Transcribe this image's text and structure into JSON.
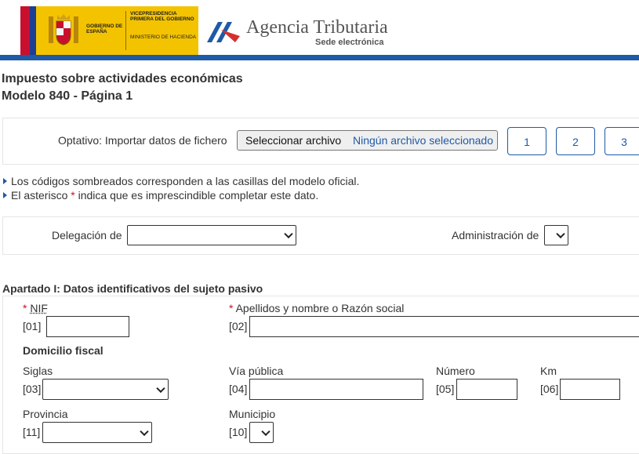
{
  "header": {
    "gov_line1": "GOBIERNO DE ESPAÑA",
    "gov_line2": "VICEPRESIDENCIA PRIMERA DEL GOBIERNO",
    "gov_line3": "MINISTERIO DE HACIENDA",
    "agency_name": "Agencia Tributaria",
    "agency_sub": "Sede electrónica",
    "colors": {
      "brand_blue": "#1f5aa6",
      "gov_yellow": "#f4c300",
      "gov_red": "#c8102e"
    }
  },
  "page": {
    "title_line1": "Impuesto sobre actividades económicas",
    "title_line2": "Modelo 840 - Página 1"
  },
  "import": {
    "label": "Optativo: Importar datos de fichero",
    "button": "Seleccionar archivo",
    "status": "Ningún archivo seleccionado",
    "pages": [
      "1",
      "2",
      "3"
    ]
  },
  "notes": {
    "line1": "Los códigos sombreados corresponden a las casillas del modelo oficial.",
    "line2_before": "El asterisco",
    "line2_star": "*",
    "line2_after": "indica que es imprescindible completar este dato."
  },
  "admin": {
    "delegacion_label": "Delegación de",
    "administracion_label": "Administración de"
  },
  "section1": {
    "title": "Apartado I: Datos identificativos del sujeto pasivo",
    "required_star": "*",
    "nif_label": "NIF",
    "nif_code": "[01]",
    "nombre_label": "Apellidos y nombre o Razón social",
    "nombre_code": "[02]",
    "domicilio_heading": "Domicilio fiscal",
    "siglas_label": "Siglas",
    "siglas_code": "[03]",
    "via_label": "Vía pública",
    "via_code": "[04]",
    "numero_label": "Número",
    "numero_code": "[05]",
    "km_label": "Km",
    "km_code": "[06]",
    "provincia_label": "Provincia",
    "provincia_code": "[11]",
    "municipio_label": "Municipio",
    "municipio_code": "[10]"
  }
}
